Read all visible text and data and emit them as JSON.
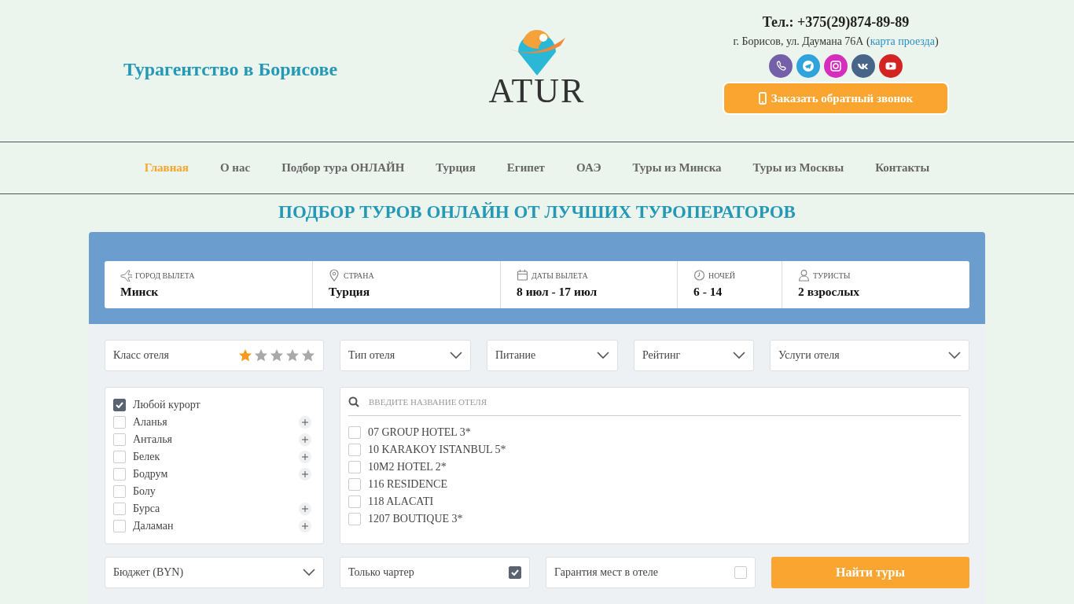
{
  "header": {
    "tagline": "Турагентство в Борисове",
    "logo": {
      "text": "ATUR"
    },
    "phone": "Тел.: +375(29)874-89-89",
    "address": {
      "before": "г. Борисов, ул. Даумана 76А (",
      "link": "карта проезда",
      "after": ")"
    },
    "socials": [
      {
        "kind": "viber"
      },
      {
        "kind": "telegram"
      },
      {
        "kind": "instagram"
      },
      {
        "kind": "vk"
      },
      {
        "kind": "youtube"
      }
    ],
    "callback_button": "Заказать обратный звонок"
  },
  "nav": [
    {
      "label": "Главная",
      "selected": true
    },
    {
      "label": "О нас",
      "selected": false
    },
    {
      "label": "Подбор тура ОНЛАЙН",
      "selected": false
    },
    {
      "label": "Турция",
      "selected": false
    },
    {
      "label": "Египет",
      "selected": false
    },
    {
      "label": "ОАЭ",
      "selected": false
    },
    {
      "label": "Туры из Минска",
      "selected": false
    },
    {
      "label": "Туры из Москвы",
      "selected": false
    },
    {
      "label": "Контакты",
      "selected": false
    }
  ],
  "page_title": "ПОДБОР ТУРОВ ОНЛАЙН ОТ ЛУЧШИХ ТУРОПЕРАТОРОВ",
  "search": {
    "fields": [
      {
        "kind": "plane",
        "label": "ГОРОД ВЫЛЕТА",
        "value": "Минск"
      },
      {
        "kind": "pin",
        "label": "СТРАНА",
        "value": "Турция"
      },
      {
        "kind": "calendar",
        "label": "ДАТЫ ВЫЛЕТА",
        "value": "8 июл - 17 июл"
      },
      {
        "kind": "clock",
        "label": "НОЧЕЙ",
        "value": "6 - 14"
      },
      {
        "kind": "person",
        "label": "ТУРИСТЫ",
        "value": "2 взрослых"
      }
    ],
    "filters": [
      {
        "kind": "stars",
        "label": "Класс отеля",
        "stars": 1
      },
      {
        "kind": "dropdown",
        "label": "Тип отеля"
      },
      {
        "kind": "dropdown",
        "label": "Питание"
      },
      {
        "kind": "dropdown",
        "label": "Рейтинг"
      },
      {
        "kind": "dropdown",
        "label": "Услуги отеля"
      }
    ],
    "resorts": [
      {
        "label": "Любой курорт",
        "checked": true,
        "expandable": false
      },
      {
        "label": "Аланья",
        "checked": false,
        "expandable": true
      },
      {
        "label": "Анталья",
        "checked": false,
        "expandable": true
      },
      {
        "label": "Белек",
        "checked": false,
        "expandable": true
      },
      {
        "label": "Бодрум",
        "checked": false,
        "expandable": true
      },
      {
        "label": "Болу",
        "checked": false,
        "expandable": false
      },
      {
        "label": "Бурса",
        "checked": false,
        "expandable": true
      },
      {
        "label": "Даламан",
        "checked": false,
        "expandable": true
      }
    ],
    "hotel_search": {
      "placeholder": "ВВЕДИТЕ НАЗВАНИЕ ОТЕЛЯ"
    },
    "hotels": [
      {
        "label": "07 GROUP HOTEL 3*",
        "checked": false
      },
      {
        "label": "10 KARAKOY ISTANBUL 5*",
        "checked": false
      },
      {
        "label": "10M2 HOTEL 2*",
        "checked": false
      },
      {
        "label": "116 RESIDENCE",
        "checked": false
      },
      {
        "label": "118 ALACATI",
        "checked": false
      },
      {
        "label": "1207 BOUTIQUE 3*",
        "checked": false
      }
    ],
    "bottom": [
      {
        "kind": "dropdown",
        "label": "Бюджет (BYN)"
      },
      {
        "kind": "checkbox",
        "label": "Только чартер",
        "checked": true
      },
      {
        "kind": "checkbox",
        "label": "Гарантия мест в отеле",
        "checked": false
      }
    ],
    "submit": "Найти туры"
  }
}
